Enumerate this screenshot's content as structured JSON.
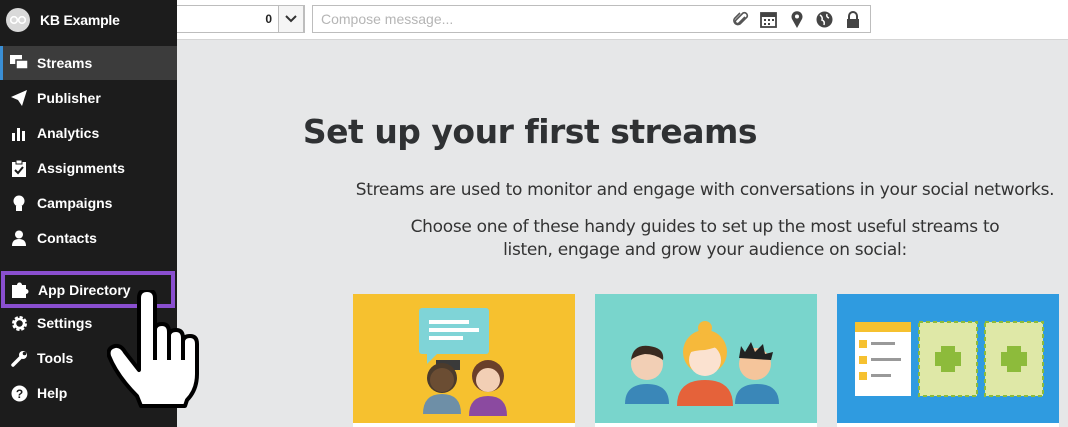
{
  "app": {
    "account_name": "KB Example"
  },
  "sidebar": {
    "items": [
      {
        "label": "Streams",
        "icon": "streams-icon"
      },
      {
        "label": "Publisher",
        "icon": "paper-plane-icon"
      },
      {
        "label": "Analytics",
        "icon": "bar-chart-icon"
      },
      {
        "label": "Assignments",
        "icon": "clipboard-icon"
      },
      {
        "label": "Campaigns",
        "icon": "lightbulb-icon"
      },
      {
        "label": "Contacts",
        "icon": "person-icon"
      },
      {
        "label": "App Directory",
        "icon": "puzzle-icon"
      },
      {
        "label": "Settings",
        "icon": "gear-icon"
      },
      {
        "label": "Tools",
        "icon": "wrench-icon"
      },
      {
        "label": "Help",
        "icon": "question-icon"
      }
    ]
  },
  "topbar": {
    "profile_count": "0",
    "compose_placeholder": "Compose message..."
  },
  "main": {
    "title": "Set up your first streams",
    "subtitle": "Streams are used to monitor and engage with conversations in your social networks.",
    "guide_text": "Choose one of these handy guides to set up the most useful streams to listen, engage and grow your audience on social:"
  },
  "colors": {
    "sidebar_bg": "#1c1c1c",
    "highlight": "#8a4fcf",
    "card_yellow": "#f6c12f",
    "card_teal": "#79d5cc",
    "card_blue": "#2f9be0"
  }
}
